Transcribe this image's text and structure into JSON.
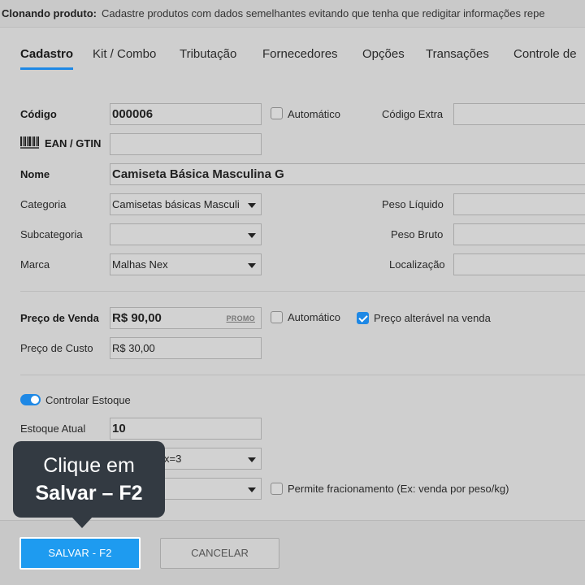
{
  "banner": {
    "label": "Clonando produto:",
    "text": "Cadastre produtos com dados semelhantes evitando que tenha que redigitar informações repe"
  },
  "tabs": [
    {
      "label": "Cadastro",
      "active": true
    },
    {
      "label": "Kit / Combo"
    },
    {
      "label": "Tributação"
    },
    {
      "label": "Fornecedores"
    },
    {
      "label": "Opções"
    },
    {
      "label": "Transações"
    },
    {
      "label": "Controle de"
    }
  ],
  "form": {
    "codigo": {
      "label": "Código",
      "value": "000006"
    },
    "automatico": {
      "label": "Automático",
      "checked": false
    },
    "codigo_extra": {
      "label": "Código Extra",
      "value": ""
    },
    "ean": {
      "label": "EAN / GTIN",
      "value": "",
      "icon": "barcode-icon"
    },
    "nome": {
      "label": "Nome",
      "value": "Camiseta Básica Masculina G"
    },
    "categoria": {
      "label": "Categoria",
      "value": "Camisetas básicas Masculi"
    },
    "peso_liquido": {
      "label": "Peso Líquido",
      "value": ""
    },
    "subcategoria": {
      "label": "Subcategoria",
      "value": ""
    },
    "peso_bruto": {
      "label": "Peso Bruto",
      "value": ""
    },
    "marca": {
      "label": "Marca",
      "value": "Malhas Nex"
    },
    "localizacao": {
      "label": "Localização",
      "value": ""
    },
    "preco_venda": {
      "label": "Preço de Venda",
      "value": "R$ 90,00",
      "promo": "PROMO"
    },
    "automatico_preco": {
      "label": "Automático",
      "checked": false
    },
    "preco_alteravel": {
      "label": "Preço alterável na venda",
      "checked": true
    },
    "preco_custo": {
      "label": "Preço de Custo",
      "value": "R$ 30,00"
    },
    "controlar_estoque": {
      "label": "Controlar Estoque",
      "on": true
    },
    "estoque_atual": {
      "label": "Estoque Atual",
      "value": "10"
    },
    "unidade_partial": {
      "value": "x=3"
    },
    "permite_fracionamento": {
      "label": "Permite fracionamento (Ex: venda por peso/kg)",
      "checked": false
    }
  },
  "buttons": {
    "save": "SALVAR - F2",
    "cancel": "CANCELAR"
  },
  "tooltip": {
    "line1": "Clique em",
    "line2": "Salvar – F2"
  },
  "colors": {
    "accent": "#1e88e5",
    "save_button": "#1e9bf0",
    "tooltip_bg": "#333a42"
  }
}
